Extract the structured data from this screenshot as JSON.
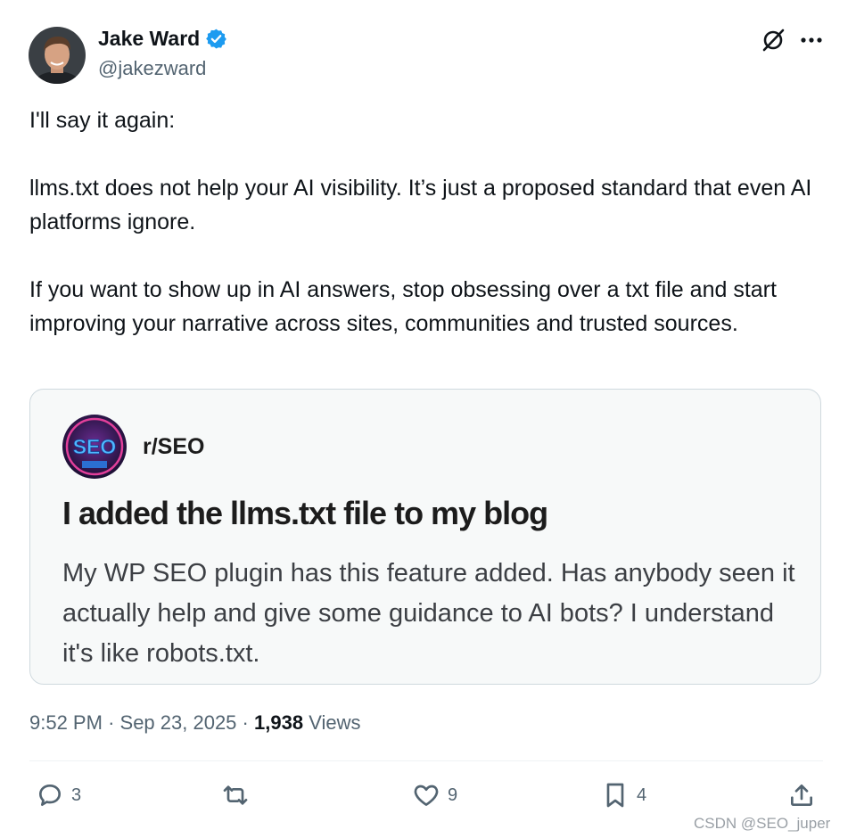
{
  "author": {
    "name": "Jake Ward",
    "handle": "@jakezward",
    "verified": true
  },
  "tweet": {
    "paragraphs": [
      "I'll say it again:",
      "llms.txt does not help your AI visibility. It’s just a proposed standard that even AI platforms ignore.",
      "If you want to show up in AI answers, stop obsessing over a txt file and start improving your narrative across sites, communities and trusted sources."
    ]
  },
  "quote": {
    "subreddit": "r/SEO",
    "avatar_text": "SEO",
    "title": "I added the llms.txt file to my blog",
    "body": "My WP SEO plugin has this feature added. Has anybody seen it actually help and give some guidance to AI bots? I understand it's like robots.txt."
  },
  "meta": {
    "time": "9:52 PM",
    "separator": "·",
    "date": "Sep 23, 2025",
    "views_count": "1,938",
    "views_label": "Views"
  },
  "actions": {
    "replies": "3",
    "reposts": "",
    "likes": "9",
    "bookmarks": "4"
  },
  "watermark": "CSDN @SEO_juper",
  "colors": {
    "accent": "#1d9bf0",
    "text": "#0f1419",
    "secondary": "#536471",
    "border": "#cfd9de"
  },
  "icons": [
    "verified-badge-icon",
    "grok-icon",
    "more-icon",
    "reply-icon",
    "repost-icon",
    "like-icon",
    "bookmark-icon",
    "share-icon"
  ]
}
